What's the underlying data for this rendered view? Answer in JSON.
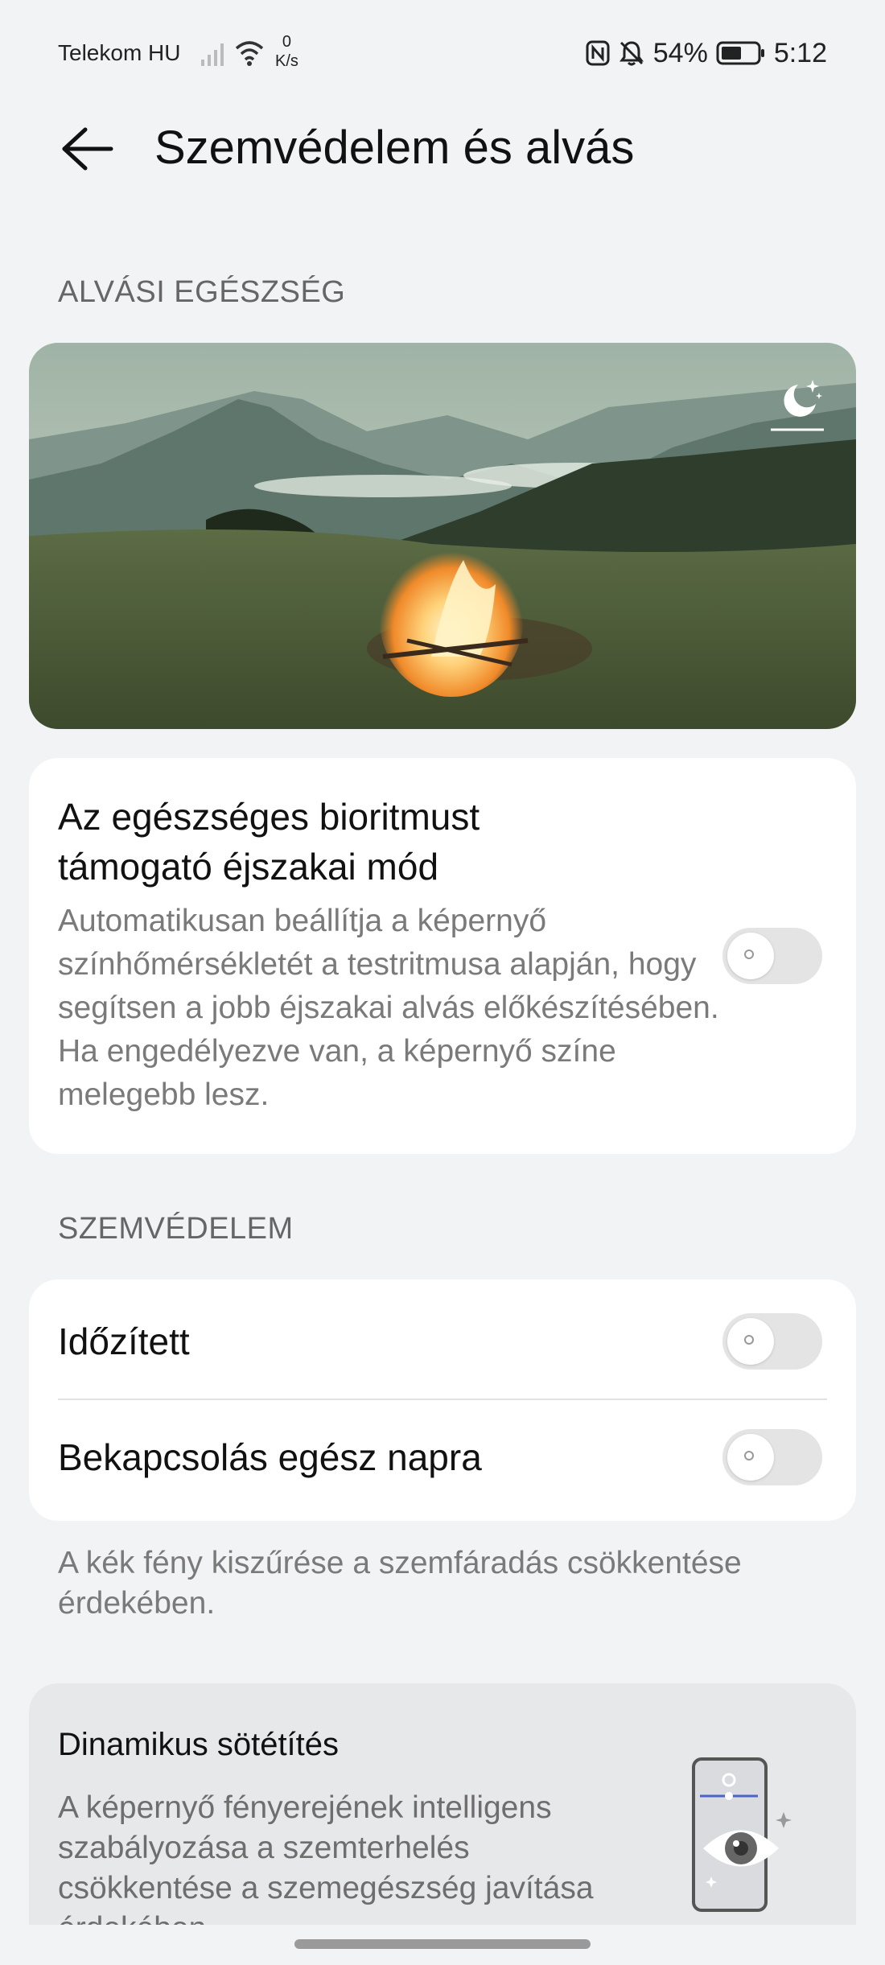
{
  "status_bar": {
    "carrier": "Telekom HU",
    "speed_value": "0",
    "speed_unit": "K/s",
    "battery": "54%",
    "time": "5:12",
    "icons": [
      "signal-icon",
      "wifi-icon",
      "nfc-icon",
      "mute-icon",
      "battery-icon"
    ]
  },
  "header": {
    "title": "Szemvédelem és alvás",
    "back_icon": "back-arrow-icon"
  },
  "sleep_section": {
    "label": "ALVÁSI EGÉSZSÉG",
    "hero_icon": "moon-stars-icon",
    "night_mode": {
      "title": "Az egészséges bioritmust támogató éjszakai mód",
      "description": "Automatikusan beállítja a képernyő színhőmérsékletét a testritmusa alapján, hogy segítsen a jobb éjszakai alvás előkészítésében. Ha engedélyezve van, a képernyő színe melegebb lesz.",
      "enabled": false
    }
  },
  "eye_section": {
    "label": "SZEMVÉDELEM",
    "rows": [
      {
        "label": "Időzített",
        "enabled": false
      },
      {
        "label": "Bekapcsolás egész napra",
        "enabled": false
      }
    ],
    "note": "A kék fény kiszűrése a szemfáradás csökkentése érdekében."
  },
  "dynamic_dimming": {
    "title": "Dinamikus sötétítés",
    "description": "A képernyő fényerejének intelligens szabályozása a szemterhelés csökkentése a szemegészség javítása érdekében"
  },
  "colors": {
    "background": "#f1f3f5",
    "card": "#ffffff",
    "secondary_text": "#7a7a7a",
    "toggle_off": "#e4e4e4"
  }
}
